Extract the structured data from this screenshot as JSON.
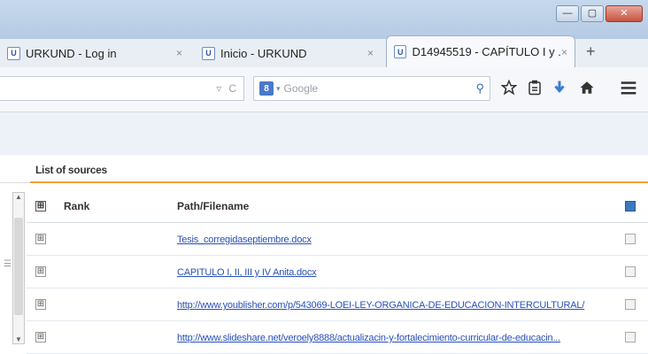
{
  "browser": {
    "tabs": [
      {
        "favicon": "U",
        "title": "URKUND - Log in",
        "close": "×"
      },
      {
        "favicon": "U",
        "title": "Inicio - URKUND",
        "close": "×"
      },
      {
        "favicon": "U",
        "title": "D14945519 - CAPÍTULO I y ...",
        "close": "×"
      }
    ],
    "new_tab": "+",
    "window_controls": {
      "minimize": "—",
      "maximize": "▢",
      "close": "✕"
    },
    "toolbar": {
      "url_dropdown_icon": "▿",
      "reload_icon": "C",
      "search_engine_icon": "8",
      "search_dropdown": "▾",
      "search_placeholder": "Google",
      "search_icon": "⚲",
      "icons": [
        "star-icon",
        "clipboard-icon",
        "download-icon",
        "home-icon",
        "menu-icon"
      ]
    }
  },
  "sources": {
    "tab_label": "List of sources",
    "columns": {
      "expand": "⊞",
      "rank": "Rank",
      "path": "Path/Filename"
    },
    "rows": [
      {
        "expand": "⊞",
        "path": "Tesis_corregidaseptiembre.docx"
      },
      {
        "expand": "⊞",
        "path": "CAPITULO I, II, III y IV Anita.docx"
      },
      {
        "expand": "⊞",
        "path": "http://www.youblisher.com/p/543069-LOEI-LEY-ORGANICA-DE-EDUCACION-INTERCULTURAL/"
      },
      {
        "expand": "⊞",
        "path": "http://www.slideshare.net/veroely8888/actualizacin-y-fortalecimiento-curricular-de-educacin..."
      }
    ]
  },
  "colors": {
    "accent": "#f0a040",
    "link": "#2a50b8",
    "header_checkbox": "#3c78c0"
  }
}
